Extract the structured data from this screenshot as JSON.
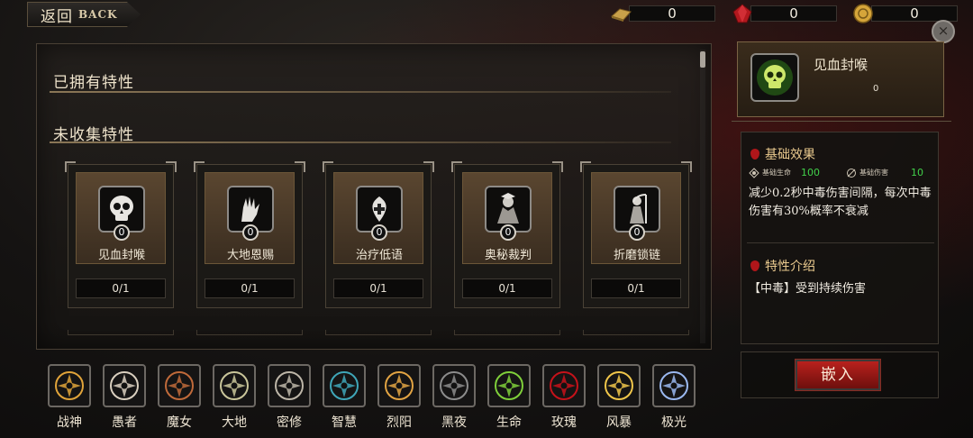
{
  "nav": {
    "back_zh": "返回",
    "back_en": "BACK"
  },
  "currencies": [
    {
      "icon": "gold-bar-icon",
      "value": "0",
      "color": "#c9a04a"
    },
    {
      "icon": "red-gem-icon",
      "value": "0",
      "color": "#b3181e"
    },
    {
      "icon": "coin-icon",
      "value": "0",
      "color": "#d6a53a"
    }
  ],
  "close": {
    "glyph": "×"
  },
  "owned": {
    "title": "已拥有特性"
  },
  "uncollected": {
    "title": "未收集特性",
    "cards": [
      {
        "name": "见血封喉",
        "count": "0",
        "progress": "0/1",
        "icon": "skull-icon"
      },
      {
        "name": "大地恩赐",
        "count": "0",
        "progress": "0/1",
        "icon": "hand-icon"
      },
      {
        "name": "治疗低语",
        "count": "0",
        "progress": "0/1",
        "icon": "healing-icon"
      },
      {
        "name": "奥秘裁判",
        "count": "0",
        "progress": "0/1",
        "icon": "arcane-judge-icon"
      },
      {
        "name": "折磨锁链",
        "count": "0",
        "progress": "0/1",
        "icon": "reaper-icon"
      }
    ]
  },
  "detail": {
    "name": "见血封喉",
    "count": "0",
    "icon": "green-skull-icon",
    "basic_title": "基础效果",
    "stats": [
      {
        "label": "基础生命",
        "value": "100",
        "icon": "life-icon"
      },
      {
        "label": "基础伤害",
        "value": "10",
        "icon": "damage-icon"
      }
    ],
    "basic_desc": "减少0.2秒中毒伤害间隔，每次中毒伤害有30%概率不衰减",
    "intro_title": "特性介绍",
    "intro_desc": "【中毒】受到持续伤害",
    "embed_label": "嵌入"
  },
  "categories": [
    {
      "label": "战神",
      "icon": "war-god-icon",
      "color": "#e1a43a"
    },
    {
      "label": "愚者",
      "icon": "fool-icon",
      "color": "#d9cfbf"
    },
    {
      "label": "魔女",
      "icon": "witch-icon",
      "color": "#c06a3a"
    },
    {
      "label": "大地",
      "icon": "earth-icon",
      "color": "#c9c59a"
    },
    {
      "label": "密修",
      "icon": "occult-icon",
      "color": "#bdb6a8"
    },
    {
      "label": "智慧",
      "icon": "wisdom-icon",
      "color": "#3fa6b8"
    },
    {
      "label": "烈阳",
      "icon": "sun-icon",
      "color": "#e2a443"
    },
    {
      "label": "黑夜",
      "icon": "night-icon",
      "color": "#8c8c8c"
    },
    {
      "label": "生命",
      "icon": "life-tree-icon",
      "color": "#7fcf3a"
    },
    {
      "label": "玫瑰",
      "icon": "rose-icon",
      "color": "#c5121a"
    },
    {
      "label": "风暴",
      "icon": "storm-icon",
      "color": "#f0c64a"
    },
    {
      "label": "极光",
      "icon": "aurora-icon",
      "color": "#9ab8f0"
    }
  ]
}
